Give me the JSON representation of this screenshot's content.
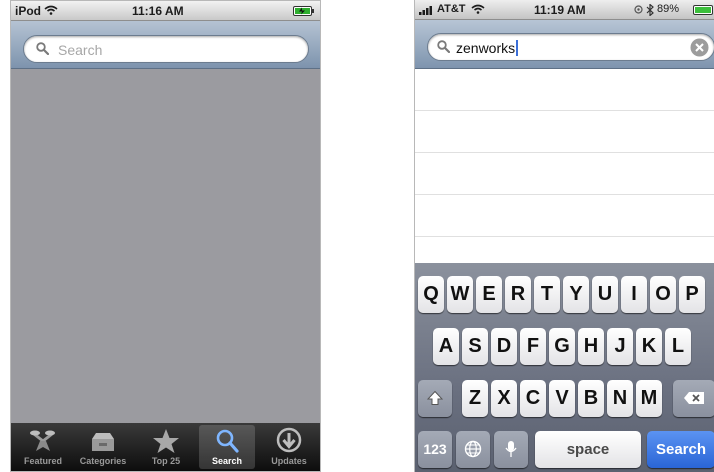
{
  "left_screen": {
    "status": {
      "carrier": "iPod",
      "time": "11:16 AM"
    },
    "search": {
      "placeholder": "Search"
    },
    "tabs": [
      {
        "label": "Featured",
        "icon": "featured-icon",
        "selected": false
      },
      {
        "label": "Categories",
        "icon": "categories-icon",
        "selected": false
      },
      {
        "label": "Top 25",
        "icon": "star-icon",
        "selected": false
      },
      {
        "label": "Search",
        "icon": "search-icon",
        "selected": true
      },
      {
        "label": "Updates",
        "icon": "download-icon",
        "selected": false
      }
    ]
  },
  "right_screen": {
    "status": {
      "carrier": "AT&T",
      "time": "11:19 AM",
      "battery": "89%"
    },
    "search": {
      "value": "zenworks"
    },
    "keyboard": {
      "row1": [
        "Q",
        "W",
        "E",
        "R",
        "T",
        "Y",
        "U",
        "I",
        "O",
        "P"
      ],
      "row2": [
        "A",
        "S",
        "D",
        "F",
        "G",
        "H",
        "J",
        "K",
        "L"
      ],
      "row3": [
        "Z",
        "X",
        "C",
        "V",
        "B",
        "N",
        "M"
      ],
      "numbers_label": "123",
      "space_label": "space",
      "search_label": "Search"
    }
  },
  "colors": {
    "search_bar_top": "#b5c3d3",
    "search_bar_bottom": "#7d93ad",
    "content_gray": "#9b9ba0",
    "keyboard_accent_blue": "#2a65d6"
  }
}
